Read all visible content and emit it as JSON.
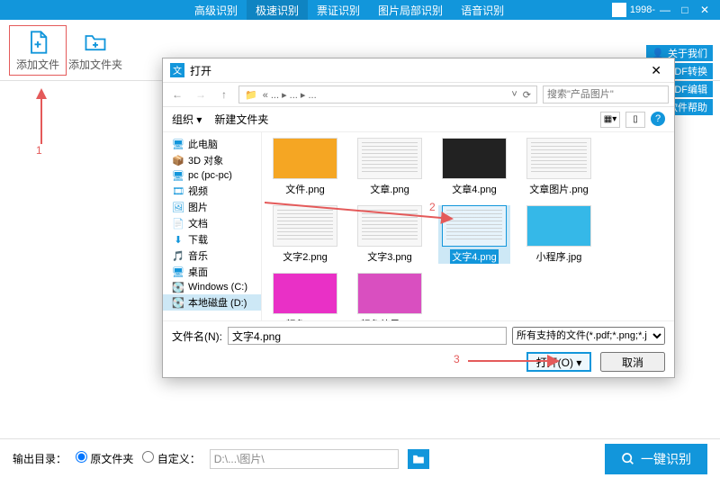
{
  "topbar": {
    "tabs": [
      "高级识别",
      "极速识别",
      "票证识别",
      "图片局部识别",
      "语音识别"
    ],
    "active_index": 1,
    "user_label": "1998-"
  },
  "toolbar": {
    "add_file": "添加文件",
    "add_folder": "添加文件夹",
    "about_us": "关于我们",
    "pdf_convert": "PDF转换",
    "pdf_edit": "PDF编辑",
    "software_help": "软件帮助"
  },
  "annotations": {
    "one": "1",
    "two": "2",
    "three": "3"
  },
  "dialog": {
    "title": "打开",
    "path_display": "« ... ▸ ... ▸ ...",
    "search_placeholder": "搜索\"产品图片\"",
    "organize": "组织 ▾",
    "new_folder": "新建文件夹",
    "tree": [
      {
        "label": "此电脑",
        "icon": "pc"
      },
      {
        "label": "3D 对象",
        "icon": "cube"
      },
      {
        "label": "pc (pc-pc)",
        "icon": "pc"
      },
      {
        "label": "视频",
        "icon": "video"
      },
      {
        "label": "图片",
        "icon": "image"
      },
      {
        "label": "文档",
        "icon": "doc"
      },
      {
        "label": "下载",
        "icon": "download"
      },
      {
        "label": "音乐",
        "icon": "music"
      },
      {
        "label": "桌面",
        "icon": "desktop"
      },
      {
        "label": "Windows (C:)",
        "icon": "drive"
      },
      {
        "label": "本地磁盘 (D:)",
        "icon": "drive"
      }
    ],
    "files": [
      {
        "name": "文件.png",
        "style": "orange"
      },
      {
        "name": "文章.png",
        "style": "lines"
      },
      {
        "name": "文章4.png",
        "style": "dark"
      },
      {
        "name": "文章图片.png",
        "style": "lines"
      },
      {
        "name": "文字2.png",
        "style": "lines"
      },
      {
        "name": "文字3.png",
        "style": "lines"
      },
      {
        "name": "文字4.png",
        "style": "lines",
        "selected": true
      },
      {
        "name": "小程序.jpg",
        "style": "blue"
      },
      {
        "name": "颜色.png",
        "style": "magenta"
      },
      {
        "name": "颜色效果.png",
        "style": "magenta2"
      }
    ],
    "filename_label": "文件名(N):",
    "filename_value": "文字4.png",
    "filter_label": "所有支持的文件(*.pdf;*.png;*.j",
    "open_btn": "打开(O)",
    "cancel_btn": "取消"
  },
  "output": {
    "label": "输出目录：",
    "opt_original": "原文件夹",
    "opt_custom": "自定义：",
    "path": "D:\\...\\图片\\",
    "main_btn": "一键识别"
  }
}
